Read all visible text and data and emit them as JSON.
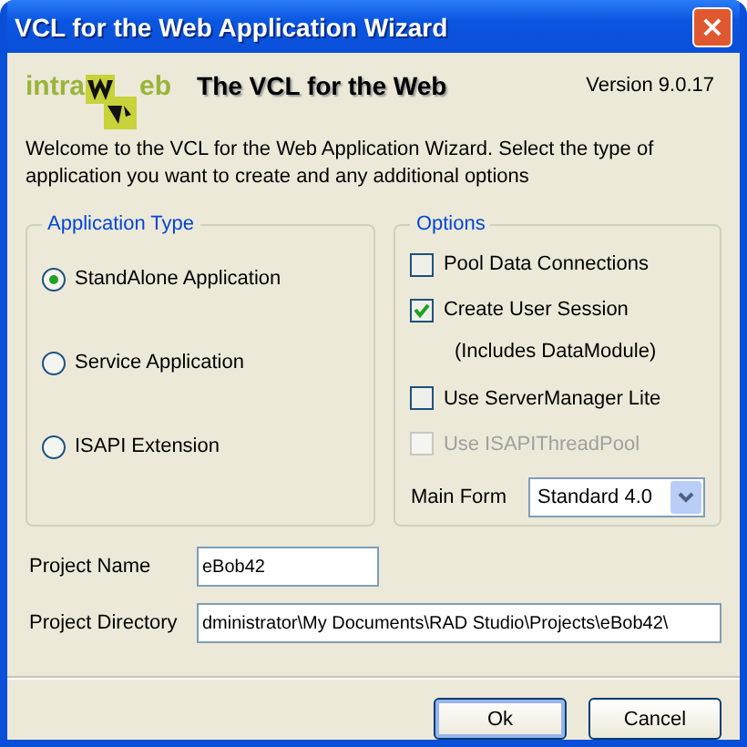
{
  "window": {
    "title": "VCL for the Web Application Wizard",
    "close": "×"
  },
  "header": {
    "logo_prefix": "intra",
    "logo_suffix": "eb",
    "tagline": "The VCL for the Web",
    "version": "Version 9.0.17"
  },
  "intro": "Welcome to the VCL for the Web Application Wizard. Select the type of application you want to create and any additional options",
  "application_type": {
    "title": "Application Type",
    "options": [
      {
        "label": "StandAlone Application",
        "selected": true
      },
      {
        "label": "Service Application",
        "selected": false
      },
      {
        "label": "ISAPI Extension",
        "selected": false
      }
    ]
  },
  "options": {
    "title": "Options",
    "items": [
      {
        "kind": "checkbox",
        "label": "Pool Data Connections",
        "checked": false,
        "disabled": false
      },
      {
        "kind": "checkbox",
        "label": "Create User Session",
        "checked": true,
        "disabled": false
      },
      {
        "kind": "note",
        "label": "(Includes DataModule)"
      },
      {
        "kind": "checkbox",
        "label": "Use ServerManager Lite",
        "checked": false,
        "disabled": false
      },
      {
        "kind": "checkbox",
        "label": "Use ISAPIThreadPool",
        "checked": false,
        "disabled": true
      }
    ],
    "main_form": {
      "label": "Main Form",
      "value": "Standard 4.0"
    }
  },
  "project_name": {
    "label": "Project Name",
    "value": "eBob42"
  },
  "project_directory": {
    "label": "Project Directory",
    "value": "dministrator\\My Documents\\RAD Studio\\Projects\\eBob42\\"
  },
  "buttons": [
    "Ok",
    "Cancel"
  ]
}
